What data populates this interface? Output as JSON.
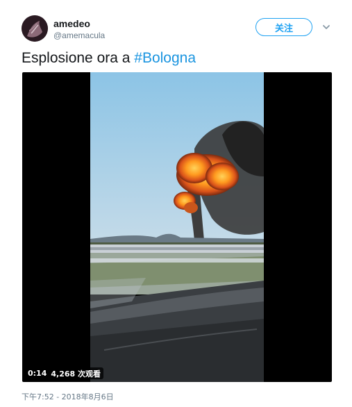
{
  "user": {
    "name": "amedeo",
    "handle": "@amemacula",
    "avatar_icon": "avatar-icon"
  },
  "actions": {
    "follow_label": "关注",
    "more_icon": "chevron-down-icon"
  },
  "tweet": {
    "text_prefix": "Esplosione ora a ",
    "hashtag": "#Bologna"
  },
  "video": {
    "duration": "0:14",
    "views": "4,268 次观看"
  },
  "meta": {
    "timestamp": "下午7:52 - 2018年8月6日"
  },
  "colors": {
    "accent": "#1da1f2",
    "hashtag": "#1b95e0",
    "secondary_text": "#657786"
  }
}
